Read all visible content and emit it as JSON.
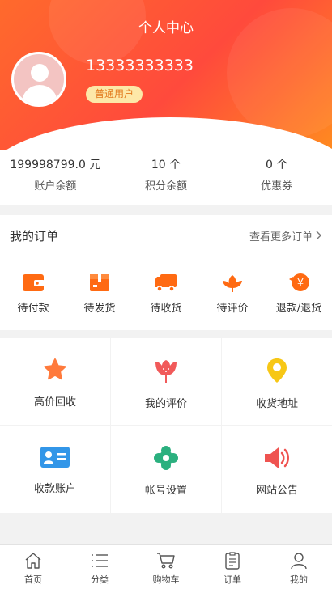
{
  "header": {
    "title": "个人中心",
    "phone": "13333333333",
    "member_badge": "普通用户"
  },
  "stats": [
    {
      "value": "199998799.0 元",
      "label": "账户余额"
    },
    {
      "value": "10 个",
      "label": "积分余额"
    },
    {
      "value": "0 个",
      "label": "优惠券"
    }
  ],
  "orders": {
    "title": "我的订单",
    "more": "查看更多订单",
    "items": [
      {
        "label": "待付款",
        "icon": "wallet-icon"
      },
      {
        "label": "待发货",
        "icon": "package-icon"
      },
      {
        "label": "待收货",
        "icon": "truck-icon"
      },
      {
        "label": "待评价",
        "icon": "flower-icon"
      },
      {
        "label": "退款/退货",
        "icon": "refund-icon"
      }
    ]
  },
  "services": [
    {
      "label": "高价回收",
      "icon": "star-icon"
    },
    {
      "label": "我的评价",
      "icon": "tulip-icon"
    },
    {
      "label": "收货地址",
      "icon": "location-pin-icon"
    },
    {
      "label": "收款账户",
      "icon": "id-card-icon"
    },
    {
      "label": "帐号设置",
      "icon": "gear-icon"
    },
    {
      "label": "网站公告",
      "icon": "megaphone-icon"
    }
  ],
  "tabbar": [
    {
      "label": "首页",
      "icon": "home-icon"
    },
    {
      "label": "分类",
      "icon": "list-icon"
    },
    {
      "label": "购物车",
      "icon": "cart-icon"
    },
    {
      "label": "订单",
      "icon": "order-doc-icon"
    },
    {
      "label": "我的",
      "icon": "user-icon"
    }
  ],
  "colors": {
    "brand_orange": "#ff6a2c",
    "star": "#ff7a3c",
    "tulip": "#f15a5a",
    "pin": "#f7c716",
    "card": "#3296e8",
    "gear": "#2bb07f",
    "megaphone": "#ef5350"
  }
}
